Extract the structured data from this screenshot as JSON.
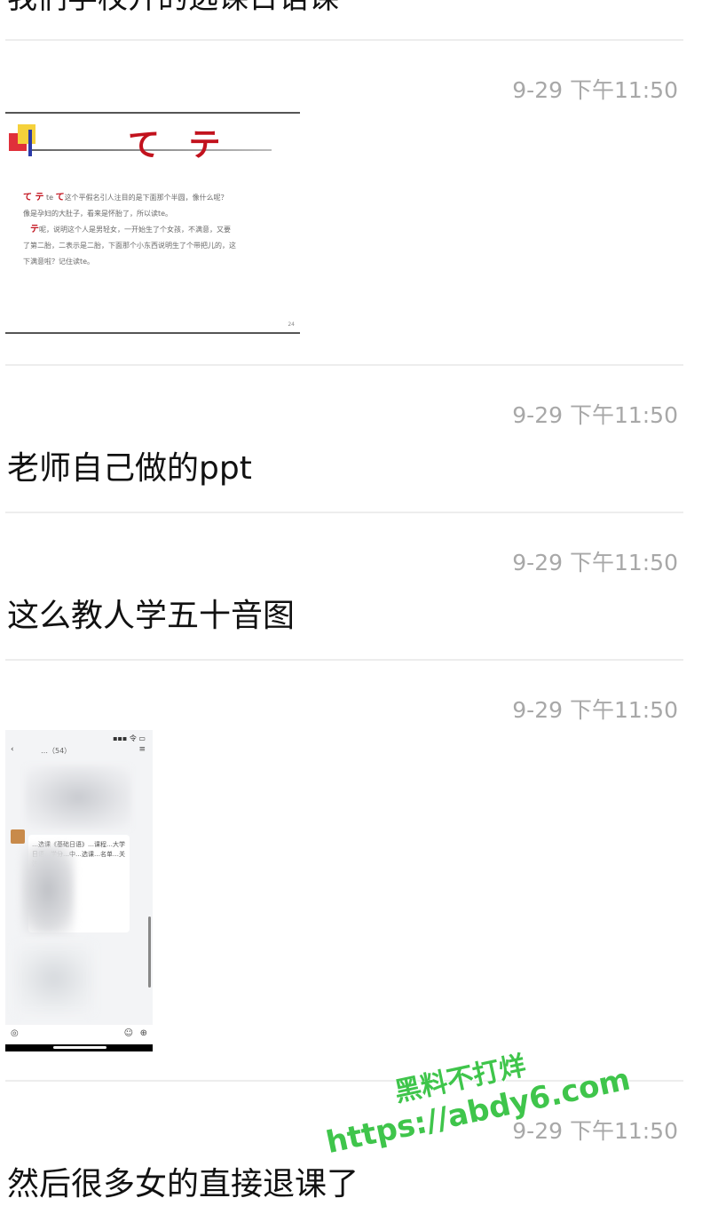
{
  "top_partial_text": "我们学校开的选课日语课",
  "messages": [
    {
      "type": "image-slide",
      "timestamp": "9-29 下午11:50"
    },
    {
      "type": "text",
      "timestamp": "9-29 下午11:50",
      "text": "老师自己做的ppt"
    },
    {
      "type": "text",
      "timestamp": "9-29 下午11:50",
      "text": "这么教人学五十音图"
    },
    {
      "type": "image-screenshot",
      "timestamp": "9-29 下午11:50"
    },
    {
      "type": "text",
      "timestamp": "9-29 下午11:50",
      "text": "然后很多女的直接退课了"
    }
  ],
  "slide": {
    "kana_title": "て テ",
    "line1_kana": "て テ",
    "line1_romaji": "te",
    "line1_kana2": "て",
    "line1_text": "这个平假名引人注目的是下面那个半圆，像什么呢？",
    "line2_text": "像是孕妇的大肚子，看来是怀胎了，所以读te。",
    "line3_kana": "テ",
    "line3_text": "呢，说明这个人是男轻女，一开始生了个女孩，不满意，又要",
    "line4_text": "了第二胎，二表示是二胎，下面那个小东西说明生了个带把儿的，这",
    "line5_text": "下满意啦？记住读te。",
    "page_number": "24"
  },
  "phone_shot": {
    "status_bar": "▪▪▪ 令 ▭",
    "nav_back": "‹",
    "nav_title": "…（54）",
    "nav_menu": "≡",
    "bubble_text": "…选课《基础日语》…课程…大学日语…学分…中…选课…名单…关注…老师",
    "input_mic": "◎",
    "input_emoji": "☺",
    "input_plus": "⊕"
  },
  "watermark": {
    "line1": "黑料不打烊",
    "line2": "https://abdy6.com"
  }
}
